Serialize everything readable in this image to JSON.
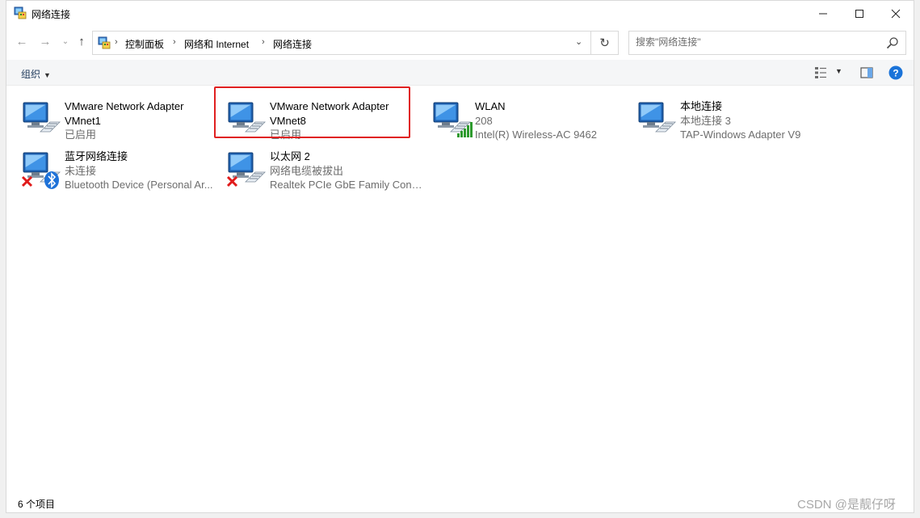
{
  "window": {
    "title": "网络连接",
    "controls": {
      "minimize": "—",
      "maximize": "☐",
      "close": "✕"
    }
  },
  "nav": {
    "back": "←",
    "forward": "→",
    "recent": "⌄",
    "up": "↑",
    "refresh": "↻",
    "dropdown": "⌄",
    "breadcrumb": [
      "控制面板",
      "网络和 Internet",
      "网络连接"
    ],
    "separator": "›",
    "search_placeholder": "搜索\"网络连接\""
  },
  "commandbar": {
    "organize": "组织",
    "organize_caret": "▼",
    "view_caret": "▼"
  },
  "items": [
    {
      "name": "VMware Network Adapter",
      "line2": "VMnet1",
      "line3": "已启用",
      "line2_gray": false,
      "overlay": "none"
    },
    {
      "name": "VMware Network Adapter",
      "line2": "VMnet8",
      "line3": "已启用",
      "line2_gray": false,
      "overlay": "none"
    },
    {
      "name": "WLAN",
      "line2": "208",
      "line3": "Intel(R) Wireless-AC 9462",
      "line2_gray": true,
      "overlay": "signal"
    },
    {
      "name": "本地连接",
      "line2": "本地连接 3",
      "line3": "TAP-Windows Adapter V9",
      "line2_gray": true,
      "overlay": "none"
    },
    {
      "name": "蓝牙网络连接",
      "line2": "未连接",
      "line3": "Bluetooth Device (Personal Ar...",
      "line2_gray": true,
      "overlay": "bluetooth"
    },
    {
      "name": "以太网 2",
      "line2": "网络电缆被拔出",
      "line3": "Realtek PCIe GbE Family Contr...",
      "line2_gray": true,
      "overlay": "cable-x"
    }
  ],
  "status": {
    "count": "6 个项目"
  },
  "watermark": "CSDN @是靓仔呀",
  "colors": {
    "highlight": "#e02020",
    "help": "#1a73d9",
    "signal": "#2d9a2d",
    "error": "#e01b1b",
    "bluetooth": "#1f72d8"
  }
}
